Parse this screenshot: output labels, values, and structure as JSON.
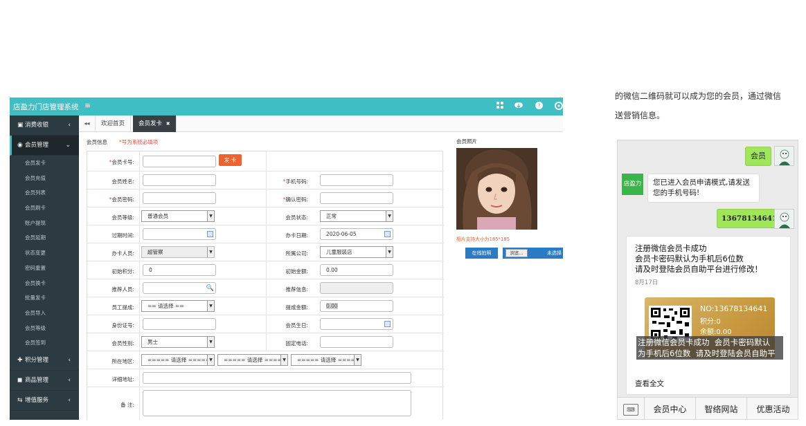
{
  "app": {
    "title": "店盈力门店管理系统",
    "menu_glyph": "≡"
  },
  "topbar_icons": [
    "grid-icon",
    "cloud-download-icon",
    "help-icon",
    "settings-icon"
  ],
  "sidebar": {
    "groups_top": [
      {
        "label": "消费收银",
        "icon": "cashier-icon"
      }
    ],
    "active_group": {
      "label": "会员管理",
      "icon": "member-icon"
    },
    "sub_items": [
      "会员发卡",
      "会员充值",
      "会员列表",
      "会员刷卡",
      "账户提现",
      "会员延期",
      "状态变更",
      "密码重置",
      "会员换卡",
      "批量发卡",
      "会员导入",
      "会员等级",
      "会员签到"
    ],
    "groups_bottom": [
      {
        "label": "积分管理",
        "icon": "points-icon"
      },
      {
        "label": "商品管理",
        "icon": "goods-icon"
      },
      {
        "label": "增值服务",
        "icon": "value-added-icon"
      }
    ]
  },
  "tabs": {
    "back_glyph": "◂◂",
    "home": "欢迎首页",
    "active": "会员发卡",
    "close_glyph": "✖"
  },
  "form": {
    "section_title": "会员信息",
    "required_note": "*号为系统必填项",
    "card_no_label": "会员卡号:",
    "issue_button": "发 卡",
    "name_label": "会员姓名:",
    "phone_label": "手机号码:",
    "password_label": "会员密码:",
    "confirm_label": "确认密码:",
    "level_label": "会员等级:",
    "level_value": "普通会员",
    "status_label": "会员状态:",
    "status_value": "正常",
    "expire_label": "过期时间:",
    "issue_date_label": "办卡日期:",
    "issue_date_value": "2020-06-05",
    "operator_label": "办卡人员:",
    "operator_value": "超管察",
    "company_label": "所属公司:",
    "company_value": "儿童服装店",
    "init_points_label": "初始积分:",
    "init_points_value": "0",
    "init_amount_label": "初始金额:",
    "init_amount_value": "0.00",
    "referrer_label": "推荐人员:",
    "referrer_info_label": "推荐信息:",
    "commission_label": "员工提成:",
    "commission_value": "== 请选择 ==",
    "commission_amount_label": "提成金额:",
    "commission_amount_value": "0.00",
    "id_label": "身份证号:",
    "birthday_label": "会员生日:",
    "gender_label": "会员性别:",
    "gender_value": "男士",
    "tel_label": "固定电话:",
    "region_label": "所在地区:",
    "region_placeholder": "===== 请选择 =====",
    "address_label": "详细地址:",
    "remark_label": "备 注:"
  },
  "photo": {
    "label": "会员照片",
    "hint": "相片支持大小为185*185",
    "online_button": "在线拍照",
    "browse_button": "浏览...",
    "not_selected": "未选择"
  },
  "article": {
    "line1": "的微信二维码就可以成为您的会员，通过微信",
    "line2": "送营销信息。"
  },
  "phone": {
    "msg_member": "会员",
    "shop_avatar": "店盈力",
    "msg_reply": "您已进入会员申请模式,请发送\n您的手机号码!",
    "msg_phone": "13678134641",
    "card_title": "注册微信会员卡成功\n会员卡密码默认为手机后6位数\n请及时登陆会员自助平台进行修改！",
    "card_date": "8月17日",
    "card_no": "NO:13678134641",
    "card_points": "积分:0",
    "card_balance": "余额:0.00",
    "card_overlay": "注册微信会员卡成功  会员卡密码默认\n为手机后6位数  请及时登陆会员自助平",
    "view_all": "查看全文",
    "menu": [
      "会员中心",
      "智络网站",
      "优惠活动"
    ]
  }
}
